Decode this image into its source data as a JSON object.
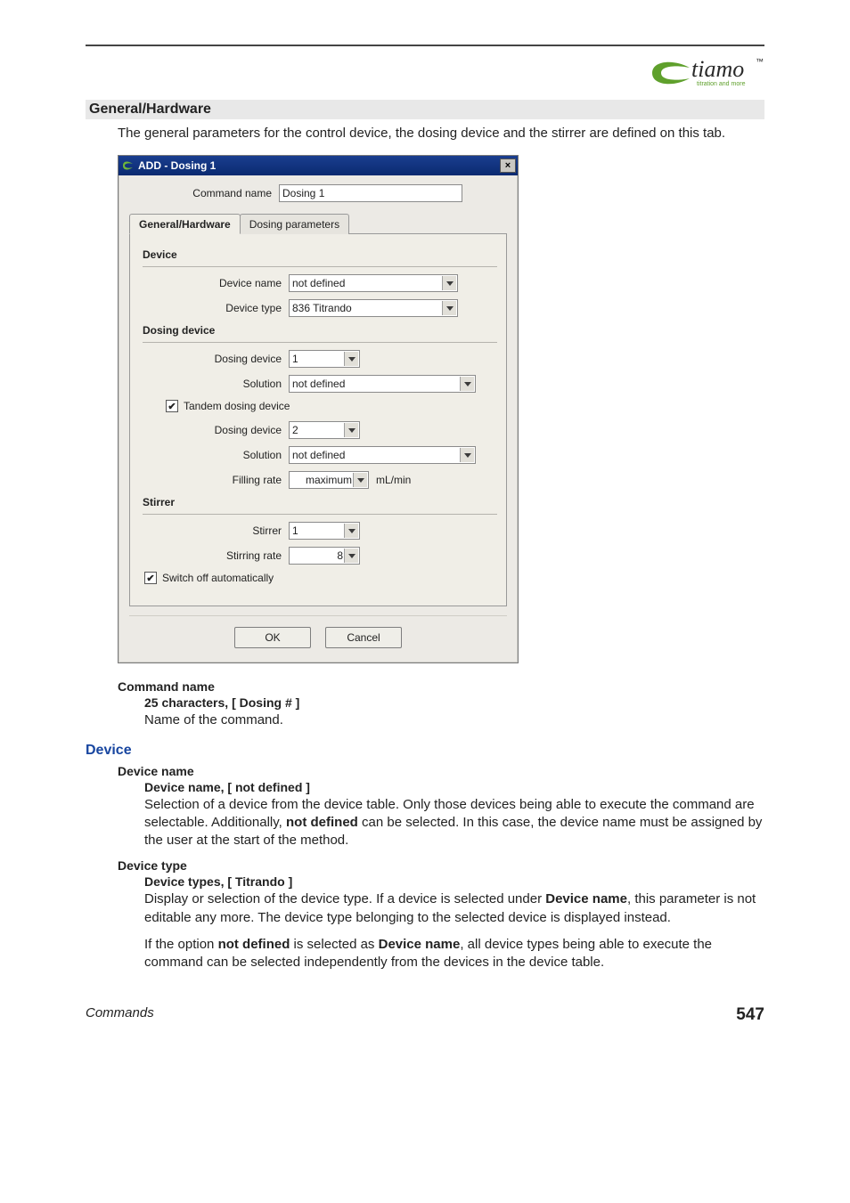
{
  "logo": {
    "brand": "tiamo",
    "tagline": "titration and more",
    "tm": "™"
  },
  "heading": "General/Hardware",
  "intro": "The general parameters for the control device, the dosing device and the stirrer are defined on this tab.",
  "dialog": {
    "title": "ADD - Dosing 1",
    "close": "×",
    "commandName": {
      "label": "Command name",
      "value": "Dosing 1"
    },
    "tabs": {
      "general": "General/Hardware",
      "dosing": "Dosing parameters"
    },
    "device": {
      "title": "Device",
      "name": {
        "label": "Device name",
        "value": "not defined"
      },
      "type": {
        "label": "Device type",
        "value": "836 Titrando"
      }
    },
    "dosingDevice": {
      "title": "Dosing device",
      "device1": {
        "label": "Dosing device",
        "value": "1"
      },
      "solution1": {
        "label": "Solution",
        "value": "not defined"
      },
      "tandem": {
        "label": "Tandem dosing device",
        "checked": true
      },
      "device2": {
        "label": "Dosing device",
        "value": "2"
      },
      "solution2": {
        "label": "Solution",
        "value": "not defined"
      },
      "fillingRate": {
        "label": "Filling rate",
        "value": "maximum",
        "unit": "mL/min"
      }
    },
    "stirrer": {
      "title": "Stirrer",
      "stirrer": {
        "label": "Stirrer",
        "value": "1"
      },
      "rate": {
        "label": "Stirring rate",
        "value": "8"
      },
      "switchOff": {
        "label": "Switch off automatically",
        "checked": true
      }
    },
    "buttons": {
      "ok": "OK",
      "cancel": "Cancel"
    }
  },
  "docs": {
    "commandName": {
      "term": "Command name",
      "sub": "25 characters, [ Dosing # ]",
      "desc": "Name of the command."
    },
    "deviceHeading": "Device",
    "deviceName": {
      "term": "Device name",
      "sub": "Device name, [ not defined ]",
      "desc_pre": "Selection of a device from the device table. Only those devices being able to execute the command are selectable. Additionally, ",
      "bold": "not defined",
      "desc_post": " can be selected. In this case, the device name must be assigned by the user at the start of the method."
    },
    "deviceType": {
      "term": "Device type",
      "sub": "Device types, [ Titrando ]",
      "p1_pre": "Display or selection of the device type. If a device is selected under ",
      "p1_b1": "Device name",
      "p1_post": ", this parameter is not editable any more. The device type belonging to the selected device is displayed instead.",
      "p2_pre": "If the option ",
      "p2_b1": "not defined",
      "p2_mid": " is selected as ",
      "p2_b2": "Device name",
      "p2_post": ", all device types being able to execute the command can be selected independently from the devices in the device table."
    }
  },
  "footer": {
    "left": "Commands",
    "right": "547"
  }
}
